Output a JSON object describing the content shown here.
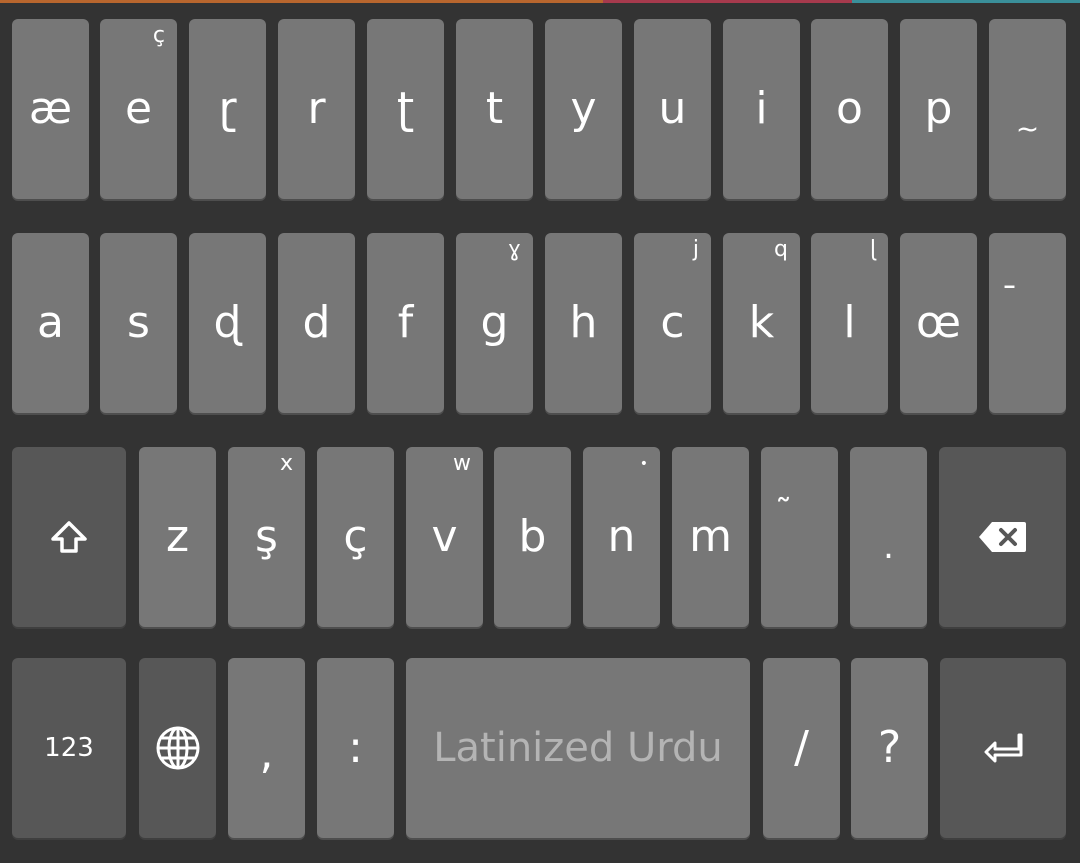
{
  "keyboard": {
    "row1": {
      "k1": {
        "main": "æ"
      },
      "k2": {
        "main": "e",
        "hint": "ç"
      },
      "k3": {
        "main": "ɽ"
      },
      "k4": {
        "main": "r"
      },
      "k5": {
        "main": "ʈ"
      },
      "k6": {
        "main": "t"
      },
      "k7": {
        "main": "y"
      },
      "k8": {
        "main": "u"
      },
      "k9": {
        "main": "i"
      },
      "k10": {
        "main": "o"
      },
      "k11": {
        "main": "p"
      },
      "k12": {
        "main": "~"
      }
    },
    "row2": {
      "k1": {
        "main": "a"
      },
      "k2": {
        "main": "s"
      },
      "k3": {
        "main": "ɖ"
      },
      "k4": {
        "main": "d"
      },
      "k5": {
        "main": "f"
      },
      "k6": {
        "main": "g",
        "hint": "ɣ"
      },
      "k7": {
        "main": "h"
      },
      "k8": {
        "main": "c",
        "hint": "j"
      },
      "k9": {
        "main": "k",
        "hint": "q"
      },
      "k10": {
        "main": "l",
        "hint": "ɭ"
      },
      "k11": {
        "main": "œ"
      },
      "k12": {
        "main": "¯"
      }
    },
    "row3": {
      "shift": {
        "icon": "shift-icon"
      },
      "k1": {
        "main": "z"
      },
      "k2": {
        "main": "ş",
        "hint": "x"
      },
      "k3": {
        "main": "ç"
      },
      "k4": {
        "main": "v",
        "hint": "w"
      },
      "k5": {
        "main": "b"
      },
      "k6": {
        "main": "n",
        "hint": "•"
      },
      "k7": {
        "main": "m"
      },
      "k8": {
        "main": "˜"
      },
      "k9": {
        "main": "."
      },
      "backspace": {
        "icon": "backspace-icon"
      }
    },
    "row4": {
      "numbers": {
        "label": "123"
      },
      "globe": {
        "icon": "globe-icon"
      },
      "comma": {
        "main": ","
      },
      "colon": {
        "main": ":"
      },
      "space": {
        "label": "Latinized Urdu"
      },
      "slash": {
        "main": "/"
      },
      "question": {
        "main": "?"
      },
      "enter": {
        "icon": "enter-icon"
      }
    }
  },
  "colors": {
    "background": "#333333",
    "key": "#777777",
    "key_dark": "#575757",
    "text": "#ffffff",
    "space_text": "#b4b4b4"
  }
}
